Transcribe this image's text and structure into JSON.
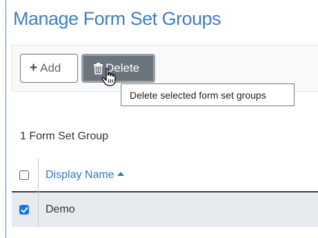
{
  "page": {
    "title": "Manage Form Set Groups"
  },
  "toolbar": {
    "add_label": "Add",
    "delete_label": "Delete",
    "delete_tooltip": "Delete selected form set groups"
  },
  "grid": {
    "count_text": "1 Form Set Group",
    "columns": [
      {
        "label": "Display Name",
        "sort": "ascending"
      }
    ],
    "rows": [
      {
        "display_name": "Demo",
        "selected": true
      }
    ],
    "select_all_checked": false
  },
  "colors": {
    "accent": "#3f7fc3",
    "link": "#2f78c4",
    "delete_button_bg": "#6c757d",
    "checkbox_checked": "#1a73e8",
    "selected_row_bg": "#e7ebef"
  },
  "icons": {
    "add": "plus-icon",
    "delete": "trash-icon",
    "cursor": "hand-pointer-icon",
    "sort": "sort-ascending-icon"
  }
}
